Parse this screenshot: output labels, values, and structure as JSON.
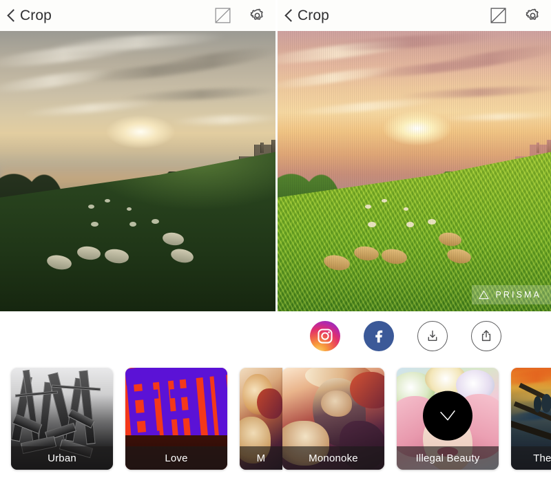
{
  "app": {
    "name": "Prisma",
    "watermark_text": "PRISMA",
    "watermark_icon": "triangle-outline-icon"
  },
  "panes": [
    {
      "id": "original",
      "header": {
        "back_label": "Crop",
        "back_icon": "chevron-left-icon",
        "compare_icon": "square-diagonal-compare-icon",
        "settings_icon": "gear-icon"
      },
      "photo": {
        "alt": "Sunset over green hillside with grazing sheep and Georgian terrace buildings",
        "style": "original",
        "watermark_visible": false
      }
    },
    {
      "id": "stylized",
      "header": {
        "back_label": "Crop",
        "back_icon": "chevron-left-icon",
        "compare_icon": "square-diagonal-compare-icon",
        "settings_icon": "gear-icon"
      },
      "photo": {
        "alt": "Same hillside sunset scene rendered as a vivid painterly artwork",
        "style": "stylized",
        "watermark_visible": true
      }
    }
  ],
  "share": {
    "buttons": [
      {
        "name": "instagram",
        "icon": "instagram-icon",
        "color": "#e1306c",
        "style": "filled"
      },
      {
        "name": "facebook",
        "icon": "facebook-icon",
        "color": "#3b5998",
        "style": "filled"
      },
      {
        "name": "download",
        "icon": "download-icon",
        "color": "#5c5c5e",
        "style": "outline"
      },
      {
        "name": "share",
        "icon": "share-upload-icon",
        "color": "#5c5c5e",
        "style": "outline"
      }
    ]
  },
  "filters": {
    "selected": "Illegal Beauty",
    "selected_icon": "checkmark-icon",
    "items": [
      {
        "label": "Urban",
        "selected": false
      },
      {
        "label": "Love",
        "selected": false
      },
      {
        "label": "M",
        "selected": false
      },
      {
        "label": "Mononoke",
        "selected": false
      },
      {
        "label": "Illegal Beauty",
        "selected": true
      },
      {
        "label": "The Scream",
        "selected": false
      }
    ]
  }
}
